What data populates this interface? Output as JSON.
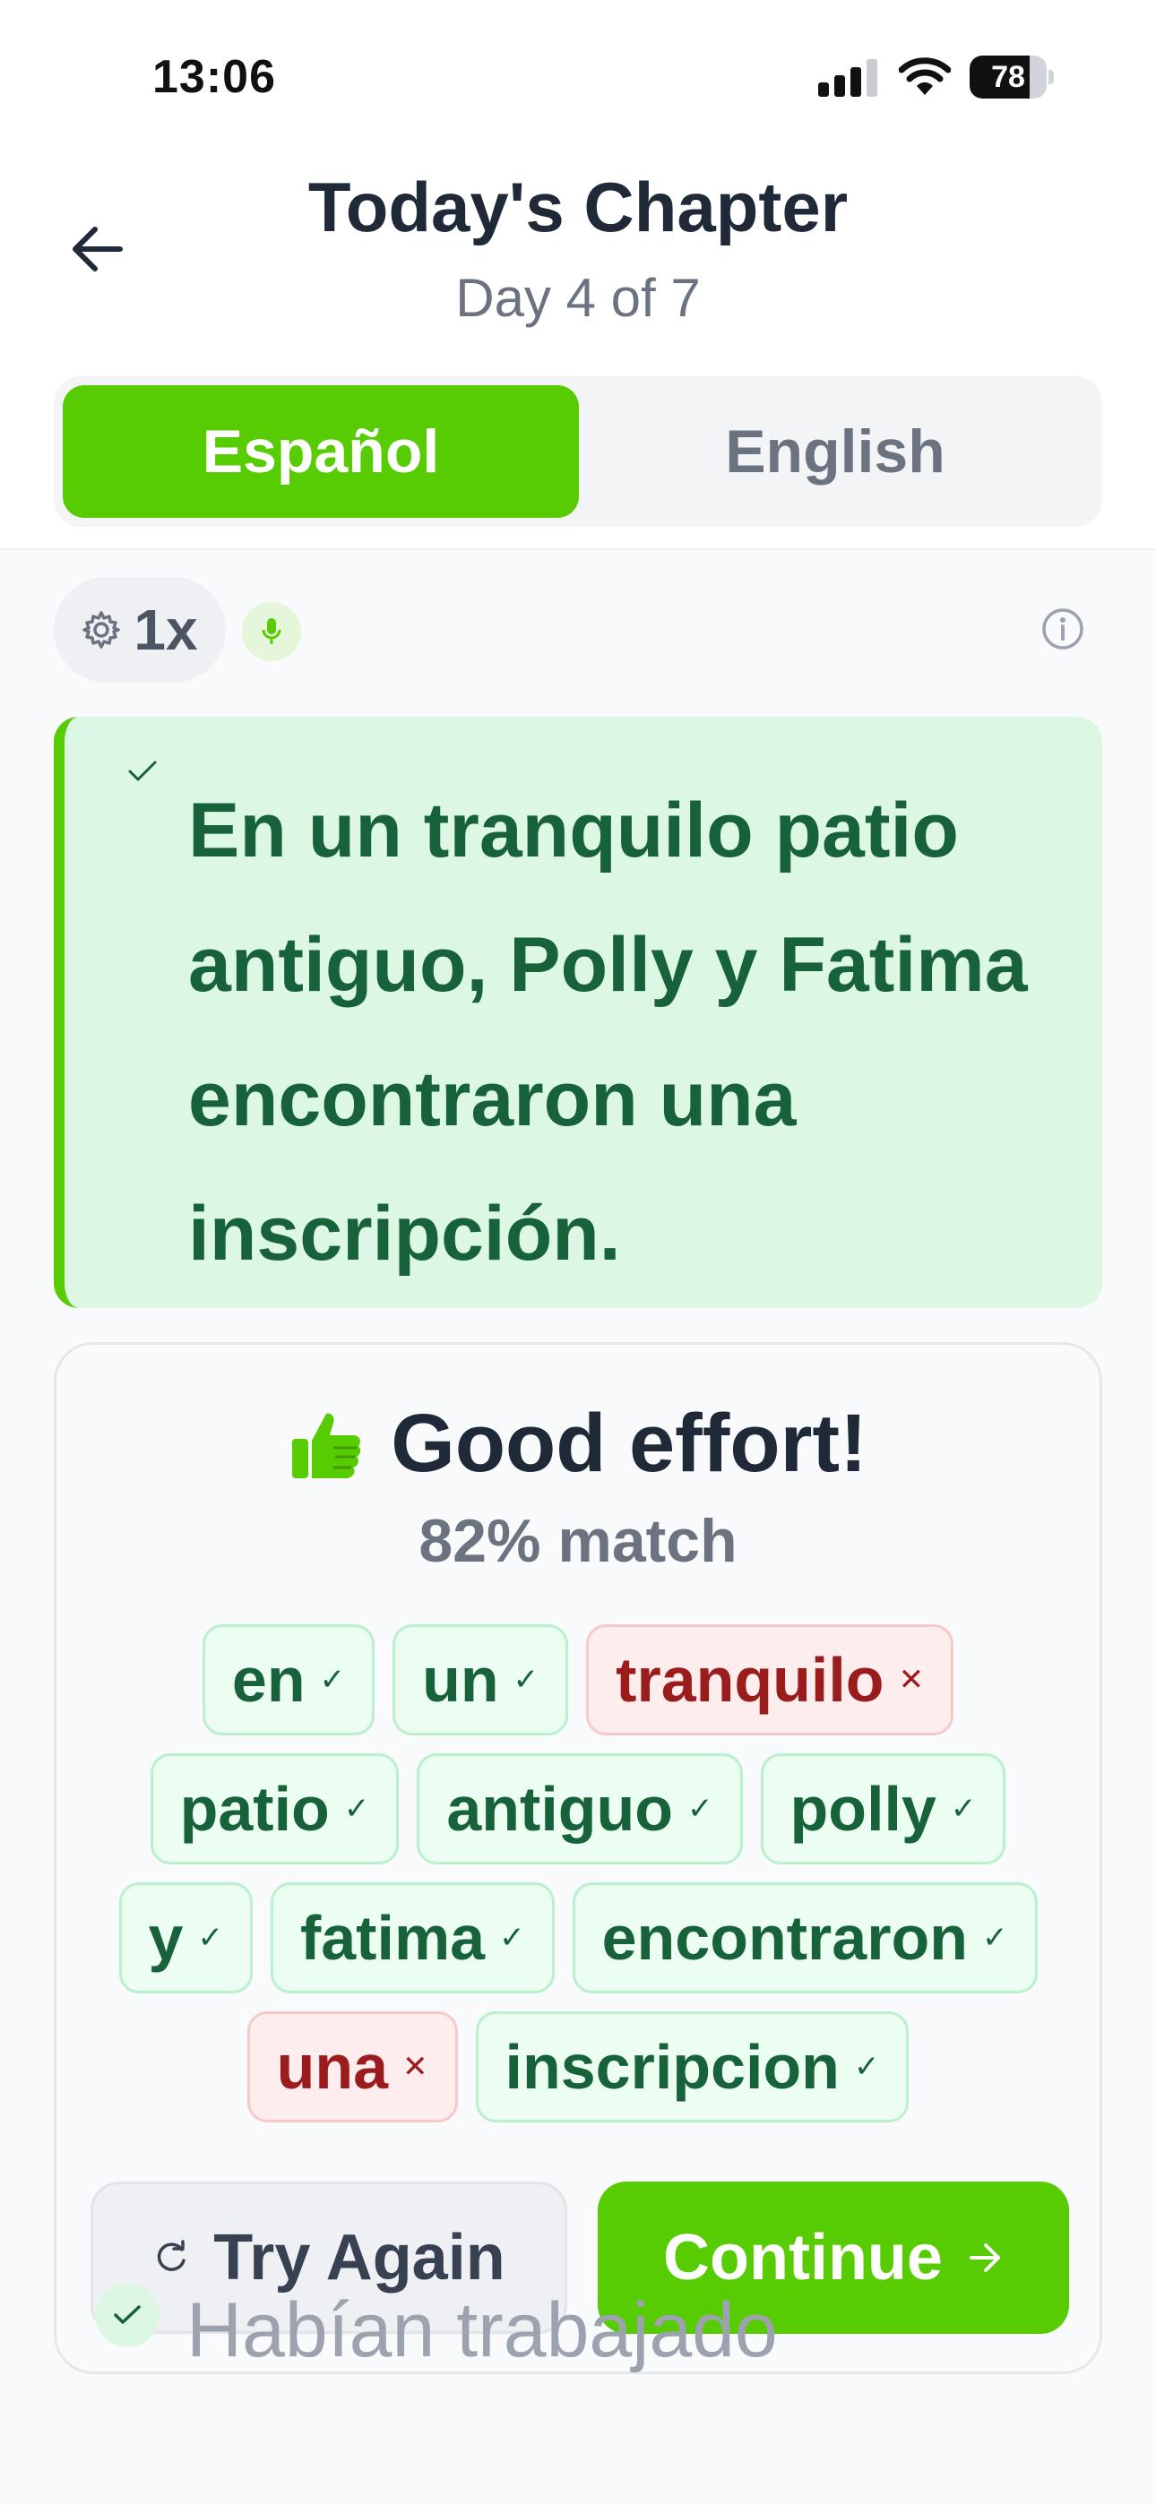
{
  "status_bar": {
    "time": "13:06",
    "battery": "78",
    "battery_level": 0.78
  },
  "header": {
    "title": "Today's Chapter",
    "subtitle": "Day 4 of 7",
    "back_icon": "arrow-left-icon"
  },
  "language_toggle": {
    "active": "Español",
    "inactive": "English"
  },
  "controls": {
    "speed": "1x",
    "icons": [
      "gear-icon",
      "microphone-icon",
      "info-icon"
    ]
  },
  "sentence": {
    "text": "En un tranquilo patio antiguo, Polly y Fatima encontraron una inscripción."
  },
  "result": {
    "title": "Good effort!",
    "match": "82% match",
    "words": [
      {
        "text": "en",
        "correct": true
      },
      {
        "text": "un",
        "correct": true
      },
      {
        "text": "tranquilo",
        "correct": false
      },
      {
        "text": "patio",
        "correct": true
      },
      {
        "text": "antiguo",
        "correct": true
      },
      {
        "text": "polly",
        "correct": true
      },
      {
        "text": "y",
        "correct": true
      },
      {
        "text": "fatima",
        "correct": true
      },
      {
        "text": "encontraron",
        "correct": true
      },
      {
        "text": "una",
        "correct": false
      },
      {
        "text": "inscripcion",
        "correct": true
      }
    ],
    "try_again": "Try Again",
    "continue": "Continue"
  },
  "next_sentence": {
    "text": "Habían trabajado"
  },
  "colors": {
    "accent": "#58cc02",
    "correct_text": "#17623a",
    "wrong_text": "#9b1c1c"
  }
}
